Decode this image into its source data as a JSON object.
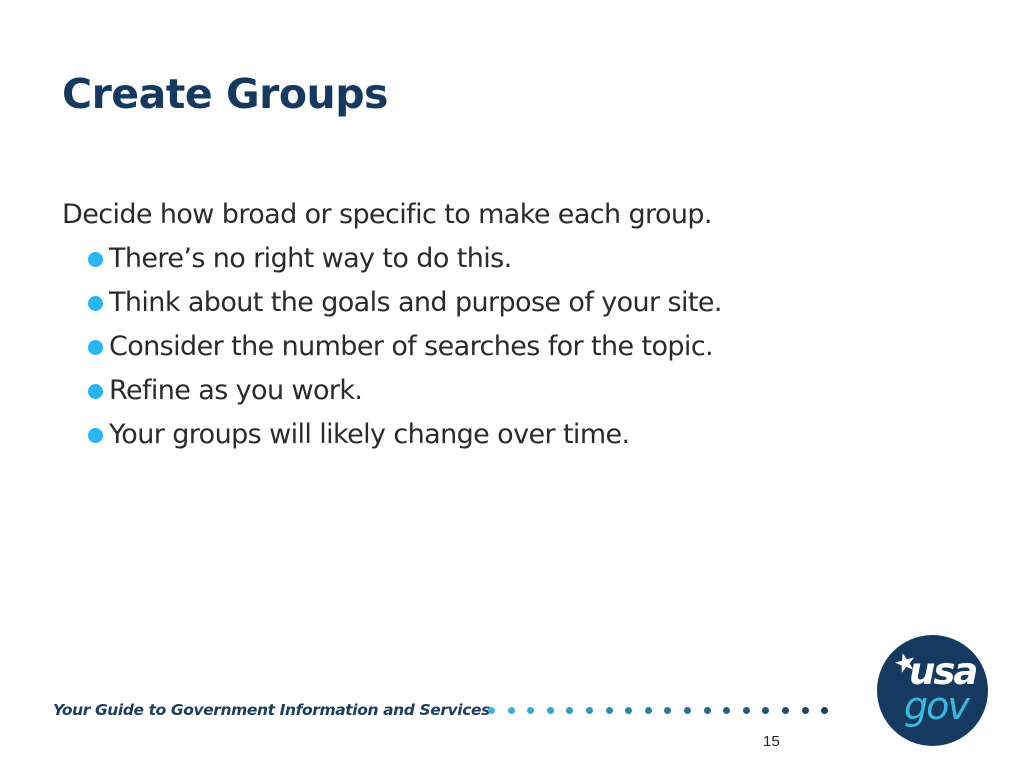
{
  "slide": {
    "title": "Create Groups",
    "intro": "Decide how broad or specific to make each group.",
    "bullets": [
      "There’s no right way to do this.",
      "Think about the goals and purpose of your site.",
      "Consider the number of searches for the topic.",
      "Refine as you work.",
      "Your groups will likely change over time."
    ],
    "page_number": "15"
  },
  "footer": {
    "tagline": "Your Guide to Government Information and Services",
    "logo": {
      "line1": "usa",
      "line2": "gov",
      "icon": "star-icon"
    },
    "dot_colors": [
      "#3ab8e0",
      "#1c3d5e"
    ]
  },
  "colors": {
    "title": "#163a5f",
    "bullet": "#29b5f0",
    "body_text": "#2b2b2b",
    "logo_bg": "#163a5f",
    "logo_accent": "#3ab8e0"
  }
}
